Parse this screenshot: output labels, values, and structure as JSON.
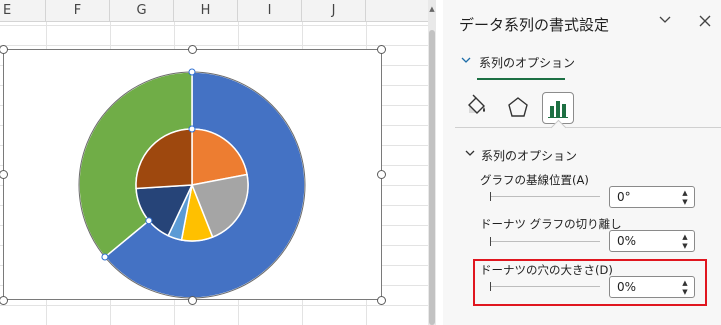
{
  "sheet": {
    "columns": [
      "E",
      "F",
      "G",
      "H",
      "I",
      "J"
    ]
  },
  "chart_data": {
    "type": "pie",
    "subtype": "doughnut",
    "hole_size_percent": 0,
    "outer_ring": {
      "slices": [
        {
          "value": 64,
          "color": "#4472c4"
        },
        {
          "value": 36,
          "color": "#70ad47"
        }
      ]
    },
    "inner_ring": {
      "slices": [
        {
          "value": 22,
          "color": "#ed7d31"
        },
        {
          "value": 22,
          "color": "#a5a5a5"
        },
        {
          "value": 9,
          "color": "#ffc000"
        },
        {
          "value": 4,
          "color": "#5b9bd5"
        },
        {
          "value": 17,
          "color": "#264478"
        },
        {
          "value": 26,
          "color": "#9e480e"
        }
      ]
    }
  },
  "pane": {
    "title": "データ系列の書式設定",
    "collapse_icon": "chevron-down-icon",
    "close_icon": "close-icon",
    "options_dropdown_label": "系列のオプション",
    "tabs": [
      {
        "name": "fill-line-icon"
      },
      {
        "name": "effects-icon"
      },
      {
        "name": "series-options-icon",
        "selected": true
      }
    ],
    "section_title": "系列のオプション",
    "properties": [
      {
        "label": "グラフの基線位置(A)",
        "value": "0°"
      },
      {
        "label": "ドーナツ グラフの切り離し",
        "value": "0%"
      },
      {
        "label": "ドーナツの穴の大きさ(D)",
        "value": "0%"
      }
    ],
    "highlight_color": "#e0161f",
    "accent_color": "#1d7044"
  }
}
